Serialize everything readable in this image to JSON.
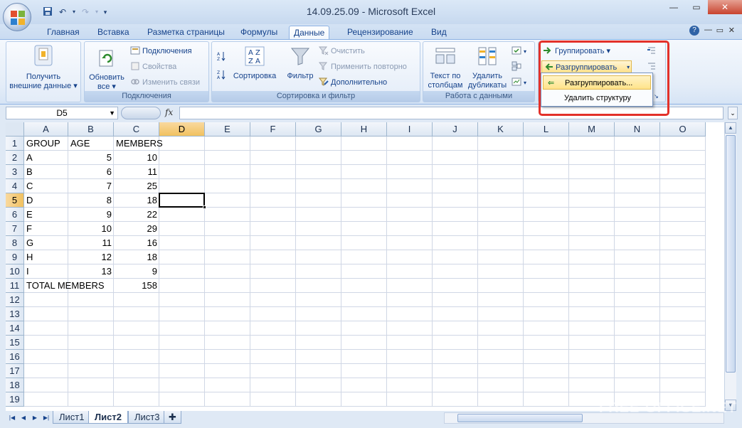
{
  "window": {
    "title": "14.09.25.09 - Microsoft Excel",
    "controls": {
      "minimize": "—",
      "maximize": "▭",
      "close": "✕"
    }
  },
  "qat": {
    "save_icon": "save-icon",
    "undo_icon": "undo-icon",
    "redo_icon": "redo-icon"
  },
  "tabs": [
    "Главная",
    "Вставка",
    "Разметка страницы",
    "Формулы",
    "Данные",
    "Рецензирование",
    "Вид"
  ],
  "active_tab": "Данные",
  "ribbon": {
    "external": {
      "label_line1": "Получить",
      "label_line2": "внешние данные ▾"
    },
    "connections": {
      "refresh_line1": "Обновить",
      "refresh_line2": "все ▾",
      "connections": "Подключения",
      "properties": "Свойства",
      "edit_links": "Изменить связи",
      "group_label": "Подключения"
    },
    "sort_filter": {
      "sort": "Сортировка",
      "filter": "Фильтр",
      "clear": "Очистить",
      "reapply": "Применить повторно",
      "advanced": "Дополнительно",
      "group_label": "Сортировка и фильтр"
    },
    "data_tools": {
      "text_to_columns_line1": "Текст по",
      "text_to_columns_line2": "столбцам",
      "remove_dups_line1": "Удалить",
      "remove_dups_line2": "дубликаты",
      "group_label": "Работа с данными"
    },
    "outline": {
      "group": "Группировать ▾",
      "ungroup": "Разгруппировать"
    }
  },
  "ungroup_menu": {
    "items": [
      "Разгруппировать...",
      "Удалить структуру"
    ]
  },
  "formula_bar": {
    "name_box": "D5",
    "fx": "fx",
    "formula": ""
  },
  "columns": [
    "A",
    "B",
    "C",
    "D",
    "E",
    "F",
    "G",
    "H",
    "I",
    "J",
    "K",
    "L",
    "M",
    "N",
    "O"
  ],
  "rows": [
    "1",
    "2",
    "3",
    "4",
    "5",
    "6",
    "7",
    "8",
    "9",
    "10",
    "11",
    "12",
    "13",
    "14",
    "15",
    "16",
    "17",
    "18",
    "19"
  ],
  "selected_cell": "D5",
  "cells": {
    "header": [
      "GROUP",
      "AGE",
      "MEMBERS"
    ],
    "data": [
      [
        "A",
        "5",
        "10"
      ],
      [
        "B",
        "6",
        "11"
      ],
      [
        "C",
        "7",
        "25"
      ],
      [
        "D",
        "8",
        "18"
      ],
      [
        "E",
        "9",
        "22"
      ],
      [
        "F",
        "10",
        "29"
      ],
      [
        "G",
        "11",
        "16"
      ],
      [
        "H",
        "12",
        "18"
      ],
      [
        "I",
        "13",
        "9"
      ]
    ],
    "total_label": "TOTAL MEMBERS",
    "total_value": "158"
  },
  "sheet_tabs": [
    "Лист1",
    "Лист2",
    "Лист3"
  ],
  "active_sheet": "Лист2",
  "watermark": "FREE-OFFICE.NET"
}
